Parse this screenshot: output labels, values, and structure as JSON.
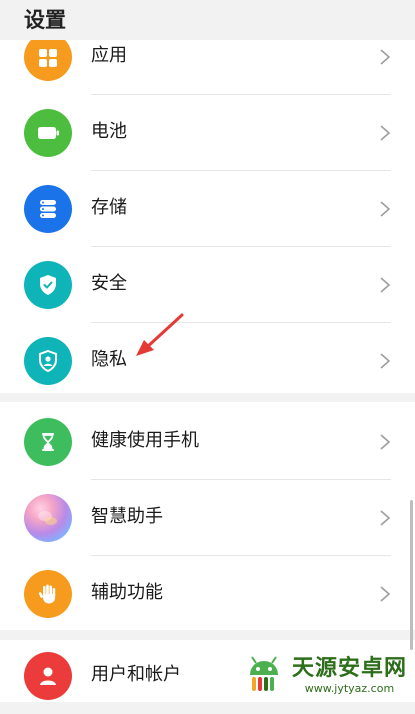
{
  "header": {
    "title": "设置"
  },
  "groups": [
    {
      "items": [
        {
          "name": "apps",
          "label": "应用",
          "icon": "apps-icon",
          "color": "#f79b1e"
        },
        {
          "name": "battery",
          "label": "电池",
          "icon": "battery-icon",
          "color": "#4cbd3f"
        },
        {
          "name": "storage",
          "label": "存储",
          "icon": "storage-icon",
          "color": "#1a73e8"
        },
        {
          "name": "security",
          "label": "安全",
          "icon": "shield-check-icon",
          "color": "#0fb4b8"
        },
        {
          "name": "privacy",
          "label": "隐私",
          "icon": "privacy-icon",
          "color": "#0fb4b8"
        }
      ]
    },
    {
      "items": [
        {
          "name": "digital-balance",
          "label": "健康使用手机",
          "icon": "hourglass-icon",
          "color": "#3ebd5e"
        },
        {
          "name": "assistant",
          "label": "智慧助手",
          "icon": "assistant-icon",
          "color": "#b98ae8"
        },
        {
          "name": "accessibility",
          "label": "辅助功能",
          "icon": "hand-icon",
          "color": "#f79b1e"
        }
      ]
    },
    {
      "items": [
        {
          "name": "accounts",
          "label": "用户和帐户",
          "icon": "user-icon",
          "color": "#ec3b3b"
        }
      ]
    }
  ],
  "annotation": {
    "icon": "red-arrow-icon",
    "color": "#e53935"
  },
  "watermark": {
    "name": "天源安卓网",
    "url": "www.jytyaz.com",
    "color": "#2c6e1a"
  }
}
